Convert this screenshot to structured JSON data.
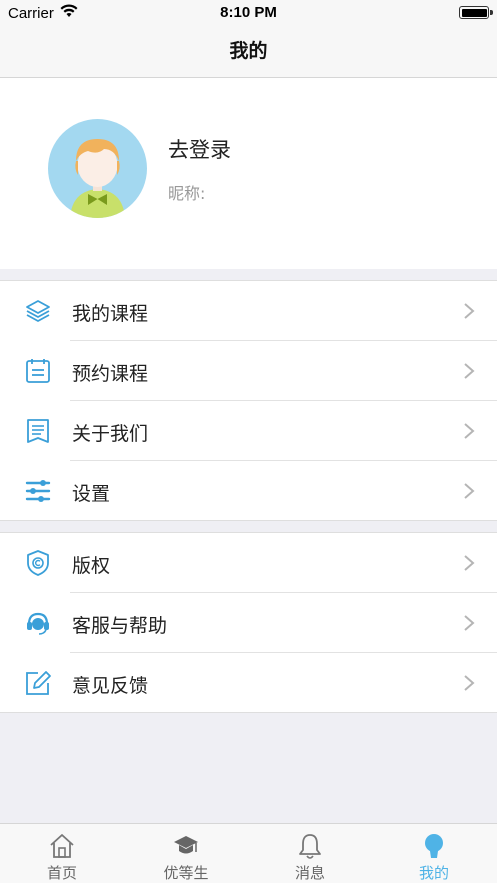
{
  "status_bar": {
    "carrier": "Carrier",
    "time": "8:10 PM"
  },
  "nav": {
    "title": "我的"
  },
  "profile": {
    "login_label": "去登录",
    "nickname_label": "昵称:"
  },
  "menu_group1": [
    {
      "label": "我的课程",
      "icon": "layers-icon"
    },
    {
      "label": "预约课程",
      "icon": "calendar-icon"
    },
    {
      "label": "关于我们",
      "icon": "document-icon"
    },
    {
      "label": "设置",
      "icon": "sliders-icon"
    }
  ],
  "menu_group2": [
    {
      "label": "版权",
      "icon": "copyright-shield-icon"
    },
    {
      "label": "客服与帮助",
      "icon": "headset-icon"
    },
    {
      "label": "意见反馈",
      "icon": "edit-icon"
    }
  ],
  "tabs": [
    {
      "label": "首页",
      "icon": "home-icon",
      "active": false
    },
    {
      "label": "优等生",
      "icon": "graduation-cap-icon",
      "active": false
    },
    {
      "label": "消息",
      "icon": "bell-icon",
      "active": false
    },
    {
      "label": "我的",
      "icon": "profile-icon",
      "active": true
    }
  ],
  "colors": {
    "accent": "#4fb3e6",
    "icon_blue": "#3a9fd8",
    "background": "#efeff4"
  }
}
